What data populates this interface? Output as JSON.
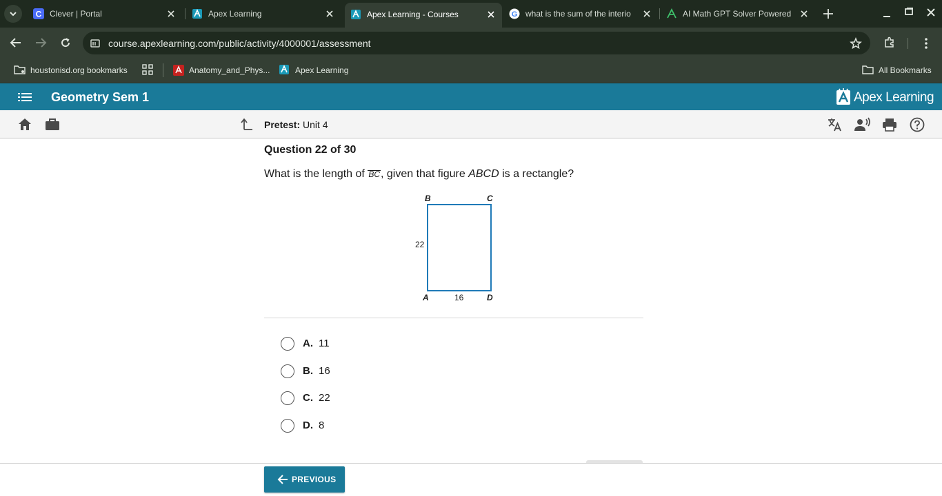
{
  "browser": {
    "tabs": [
      {
        "title": "Clever | Portal",
        "icon": "clever-icon",
        "active": false
      },
      {
        "title": "Apex Learning",
        "icon": "apex-icon",
        "active": false
      },
      {
        "title": "Apex Learning - Courses",
        "icon": "apex-icon",
        "active": true
      },
      {
        "title": "what is the sum of the interio",
        "icon": "google-icon",
        "active": false
      },
      {
        "title": "AI Math GPT Solver Powered",
        "icon": "math-gpt-icon",
        "active": false
      }
    ],
    "url": "course.apexlearning.com/public/activity/4000001/assessment",
    "bookmarks": [
      {
        "label": "houstonisd.org bookmarks",
        "icon": "managed-folder-icon"
      },
      {
        "label": "",
        "icon": "apps-grid-icon"
      },
      {
        "label": "Anatomy_and_Phys...",
        "icon": "pdf-icon"
      },
      {
        "label": "Apex Learning",
        "icon": "apex-icon"
      }
    ],
    "all_bookmarks": "All Bookmarks"
  },
  "app": {
    "course_title": "Geometry Sem 1",
    "brand": "Apex Learning",
    "brand_color": "#1a7a99",
    "pretest_label": "Pretest:",
    "pretest_value": "Unit 4"
  },
  "question": {
    "number": "Question 22 of 30",
    "text_before": "What is the length of ",
    "segment": "BC",
    "text_middle": ", given that figure ",
    "figure_name": "ABCD",
    "text_after": " is a rectangle?",
    "figure": {
      "vertex_a": "A",
      "vertex_b": "B",
      "vertex_c": "C",
      "vertex_d": "D",
      "side_ab": "22",
      "side_ad": "16",
      "stroke_color": "#1f7ab8"
    },
    "options": [
      {
        "letter": "A.",
        "value": "11"
      },
      {
        "letter": "B.",
        "value": "16"
      },
      {
        "letter": "C.",
        "value": "22"
      },
      {
        "letter": "D.",
        "value": "8"
      }
    ]
  },
  "footer": {
    "previous_label": "PREVIOUS"
  }
}
